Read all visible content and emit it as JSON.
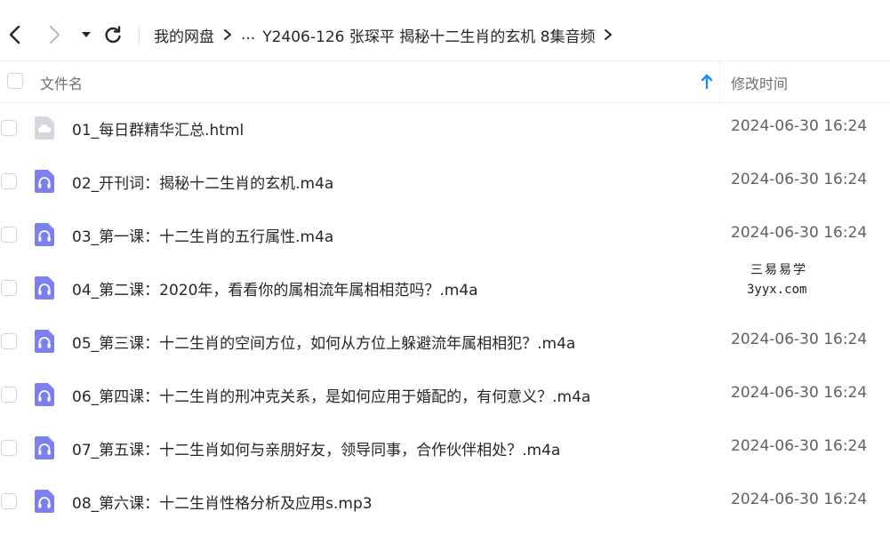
{
  "toolbar": {
    "icons": {
      "back": "chevron-left-icon",
      "forward": "chevron-right-icon",
      "history": "caret-down-icon",
      "refresh": "refresh-icon"
    },
    "breadcrumb": {
      "root": "我的网盘",
      "ellipsis": "...",
      "current": "Y2406-126 张琛平  揭秘十二生肖的玄机 8集音频"
    }
  },
  "table": {
    "header": {
      "name_label": "文件名",
      "time_label": "修改时间",
      "sort_icon": "arrow-up-icon"
    },
    "rows": [
      {
        "name": "01_每日群精华汇总.html",
        "time": "2024-06-30 16:24",
        "icon": "cloud-doc-icon"
      },
      {
        "name": "02_开刊词：揭秘十二生肖的玄机.m4a",
        "time": "2024-06-30 16:24",
        "icon": "audio-file-icon"
      },
      {
        "name": "03_第一课：十二生肖的五行属性.m4a",
        "time": "2024-06-30 16:24",
        "icon": "audio-file-icon"
      },
      {
        "name": "04_第二课：2020年，看看你的属相流年属相相范吗？.m4a",
        "time": "",
        "icon": "audio-file-icon"
      },
      {
        "name": "05_第三课：十二生肖的空间方位，如何从方位上躲避流年属相相犯？.m4a",
        "time": "2024-06-30 16:24",
        "icon": "audio-file-icon"
      },
      {
        "name": "06_第四课：十二生肖的刑冲克关系，是如何应用于婚配的，有何意义？.m4a",
        "time": "2024-06-30 16:24",
        "icon": "audio-file-icon"
      },
      {
        "name": "07_第五课：十二生肖如何与亲朋好友，领导同事，合作伙伴相处？.m4a",
        "time": "2024-06-30 16:24",
        "icon": "audio-file-icon"
      },
      {
        "name": "08_第六课：十二生肖性格分析及应用s.mp3",
        "time": "2024-06-30 16:24",
        "icon": "audio-file-icon"
      }
    ]
  },
  "watermark": {
    "line1": "三易易学",
    "line2": "3yyx.com"
  },
  "colors": {
    "audio_icon": "#7b7ff0",
    "doc_icon": "#d5d7dc",
    "sort_arrow": "#1a8cff",
    "text_primary": "#25262b",
    "text_muted": "#6b6e78"
  }
}
